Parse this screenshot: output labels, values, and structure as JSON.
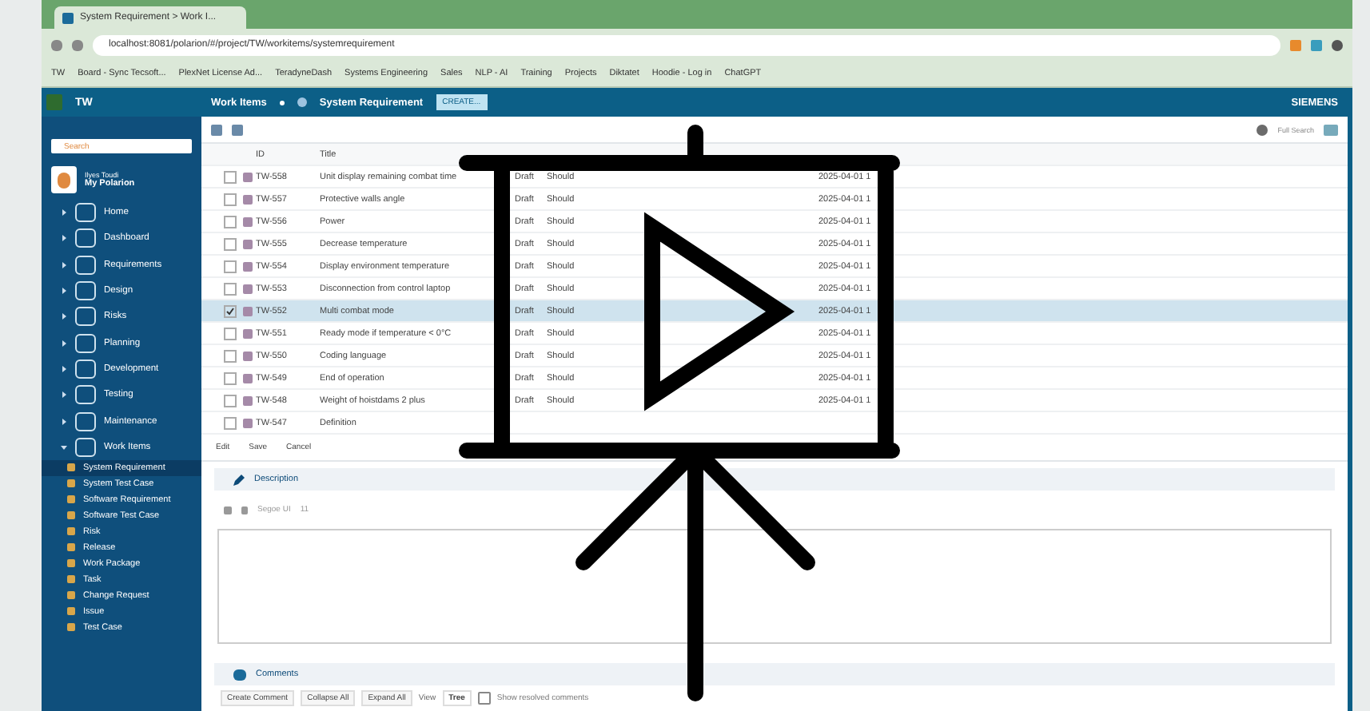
{
  "browser": {
    "tab_title": "System Requirement > Work I...",
    "url": "localhost:8081/polarion/#/project/TW/workitems/systemrequirement",
    "bookmarks": [
      {
        "label": "TW"
      },
      {
        "label": "Board - Sync Tecsoft..."
      },
      {
        "label": "PlexNet License Ad..."
      },
      {
        "label": "TeradyneDash"
      },
      {
        "label": "Systems Engineering"
      },
      {
        "label": "Sales"
      },
      {
        "label": "NLP - AI"
      },
      {
        "label": "Training"
      },
      {
        "label": "Projects"
      },
      {
        "label": "Diktatet"
      },
      {
        "label": "Hoodie - Log in"
      },
      {
        "label": "ChatGPT"
      }
    ]
  },
  "app_header": {
    "project": "TW",
    "breadcrumb": [
      "Work Items",
      "System Requirement"
    ],
    "create_button": "CREATE...",
    "brand": "SIEMENS"
  },
  "sidebar": {
    "search": {
      "placeholder": "Search"
    },
    "user": {
      "name": "Ilyes Toudi",
      "link": "My Polarion"
    },
    "items": [
      {
        "label": "Home",
        "expanded": false
      },
      {
        "label": "Dashboard",
        "expanded": false
      },
      {
        "label": "Requirements",
        "expanded": false
      },
      {
        "label": "Design",
        "expanded": false
      },
      {
        "label": "Risks",
        "expanded": false
      },
      {
        "label": "Planning",
        "expanded": false
      },
      {
        "label": "Development",
        "expanded": false
      },
      {
        "label": "Testing",
        "expanded": false
      },
      {
        "label": "Maintenance",
        "expanded": false
      },
      {
        "label": "Work Items",
        "expanded": true,
        "children": [
          {
            "label": "System Requirement",
            "selected": true
          },
          {
            "label": "System Test Case",
            "selected": false
          },
          {
            "label": "Software Requirement",
            "selected": false
          },
          {
            "label": "Software Test Case",
            "selected": false
          },
          {
            "label": "Risk",
            "selected": false
          },
          {
            "label": "Release",
            "selected": false
          },
          {
            "label": "Work Package",
            "selected": false
          },
          {
            "label": "Task",
            "selected": false
          },
          {
            "label": "Change Request",
            "selected": false
          },
          {
            "label": "Issue",
            "selected": false
          },
          {
            "label": "Test Case",
            "selected": false
          }
        ]
      }
    ]
  },
  "table": {
    "search_label": "Full Search",
    "columns": [
      "ID",
      "Title"
    ],
    "rows": [
      {
        "id": "TW-558",
        "title": "Unit display remaining combat time",
        "status": "Draft",
        "priority": "Should",
        "date": "2025-04-01 1",
        "selected": false
      },
      {
        "id": "TW-557",
        "title": "Protective walls angle",
        "status": "Draft",
        "priority": "Should",
        "date": "2025-04-01 1",
        "selected": false
      },
      {
        "id": "TW-556",
        "title": "Power",
        "status": "Draft",
        "priority": "Should",
        "date": "2025-04-01 1",
        "selected": false
      },
      {
        "id": "TW-555",
        "title": "Decrease temperature",
        "status": "Draft",
        "priority": "Should",
        "date": "2025-04-01 1",
        "selected": false
      },
      {
        "id": "TW-554",
        "title": "Display environment temperature",
        "status": "Draft",
        "priority": "Should",
        "date": "2025-04-01 1",
        "selected": false
      },
      {
        "id": "TW-553",
        "title": "Disconnection from control laptop",
        "status": "Draft",
        "priority": "Should",
        "date": "2025-04-01 1",
        "selected": false
      },
      {
        "id": "TW-552",
        "title": "Multi combat mode",
        "status": "Draft",
        "priority": "Should",
        "date": "2025-04-01 1",
        "selected": true
      },
      {
        "id": "TW-551",
        "title": "Ready mode if temperature < 0°C",
        "status": "Draft",
        "priority": "Should",
        "date": "2025-04-01 1",
        "selected": false
      },
      {
        "id": "TW-550",
        "title": "Coding language",
        "status": "Draft",
        "priority": "Should",
        "date": "2025-04-01 1",
        "selected": false
      },
      {
        "id": "TW-549",
        "title": "End of operation",
        "status": "Draft",
        "priority": "Should",
        "date": "2025-04-01 1",
        "selected": false
      },
      {
        "id": "TW-548",
        "title": "Weight of hoistdams 2 plus",
        "status": "Draft",
        "priority": "Should",
        "date": "2025-04-01 1",
        "selected": false
      },
      {
        "id": "TW-547",
        "title": "Definition",
        "status": "",
        "priority": "",
        "date": "",
        "selected": false
      }
    ]
  },
  "detail_toolbar": {
    "buttons": [
      "Edit",
      "Save",
      "Cancel"
    ]
  },
  "description": {
    "title": "Description",
    "font": "Segoe UI",
    "size": "11"
  },
  "comments": {
    "title": "Comments",
    "buttons": [
      "Create Comment",
      "Collapse All",
      "Expand All"
    ],
    "view_label": "View",
    "view_value": "Tree",
    "show_resolved": {
      "label": "Show resolved comments",
      "checked": false
    }
  }
}
